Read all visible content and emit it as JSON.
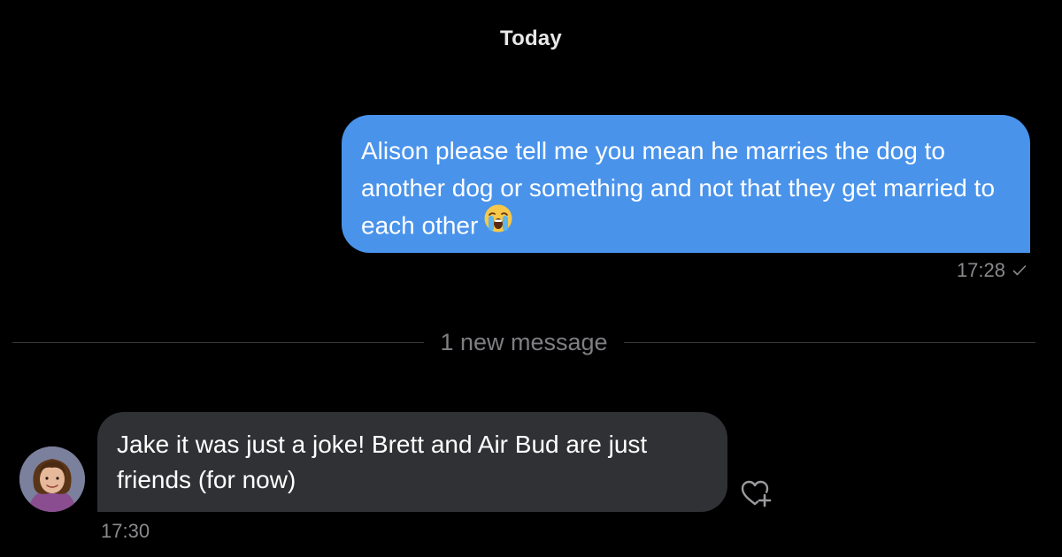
{
  "conversation": {
    "date_header": "Today",
    "messages": [
      {
        "direction": "outgoing",
        "text": "Alison please tell me you mean he marries the dog to another dog or something and not that they get married to each other",
        "emoji": "loudly-crying-face",
        "time": "17:28",
        "status": "read-check-icon"
      },
      {
        "direction": "incoming",
        "text": "Jake it was just a joke! Brett and Air Bud are just friends (for now)",
        "time": "17:30",
        "avatar": "contact-avatar-photo"
      }
    ],
    "new_message_divider": "1 new message"
  },
  "colors": {
    "background": "#000000",
    "outgoing_bubble": "#4993eb",
    "incoming_bubble": "#303134",
    "meta_text": "#8a8a8e",
    "divider_line": "#3a3a3c"
  },
  "icons": {
    "check": "check-icon",
    "reaction": "heart-plus-icon",
    "emoji": "loudly-crying-face-emoji"
  }
}
